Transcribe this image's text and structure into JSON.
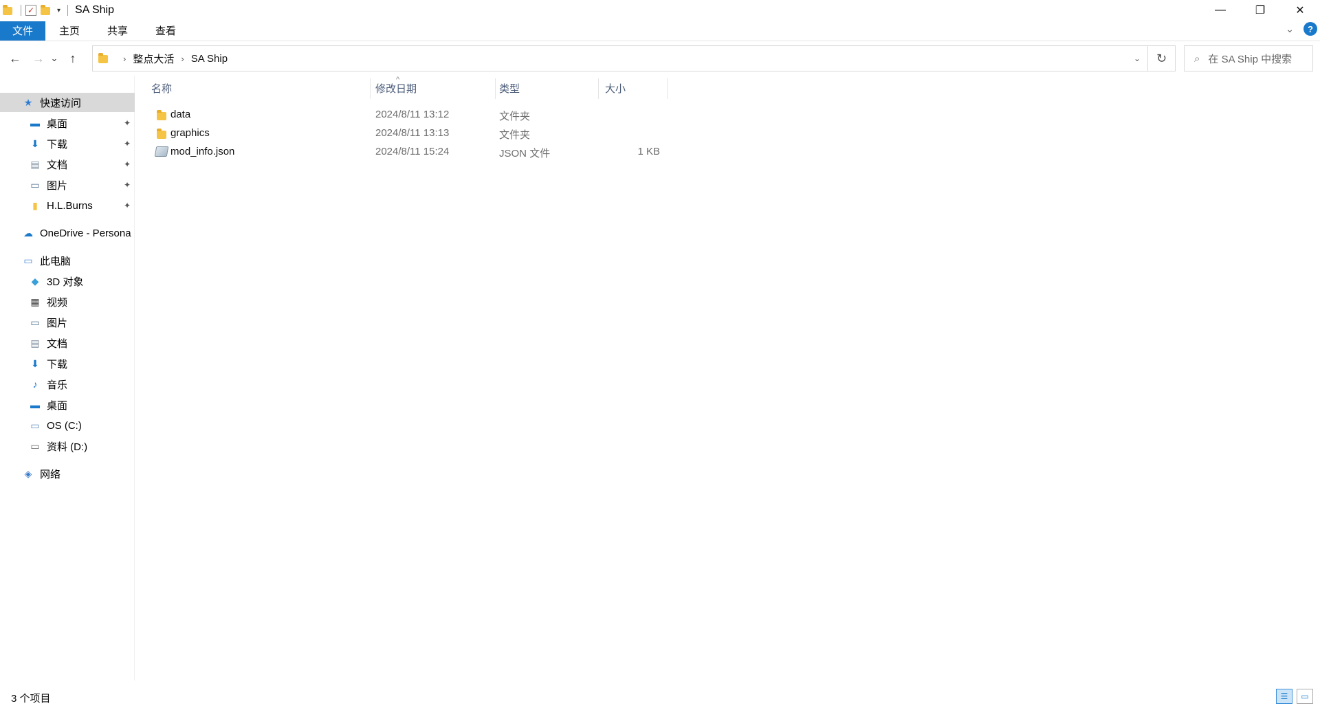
{
  "titlebar": {
    "title": "SA Ship",
    "qat_icons": [
      "folder-icon",
      "properties-icon",
      "new-folder-icon"
    ],
    "controls": {
      "minimize": "—",
      "restore": "❐",
      "close": "✕"
    }
  },
  "ribbon": {
    "tabs": [
      "文件",
      "主页",
      "共享",
      "查看"
    ],
    "expand_icon": "⌄",
    "help_icon": "?"
  },
  "navigation": {
    "back": "←",
    "forward": "→",
    "recent": "⌄",
    "up": "↑"
  },
  "address": {
    "crumbs": [
      "整点大活",
      "SA Ship"
    ],
    "separator": "›",
    "dropdown": "⌄",
    "refresh": "↻"
  },
  "search": {
    "placeholder": "在 SA Ship 中搜索",
    "icon": "⌕"
  },
  "sidebar": {
    "items": [
      {
        "label": "快速访问",
        "icon": "★",
        "pinned": false
      },
      {
        "label": "桌面",
        "icon": "▬",
        "pinned": true
      },
      {
        "label": "下载",
        "icon": "⬇",
        "pinned": true
      },
      {
        "label": "文档",
        "icon": "▤",
        "pinned": true
      },
      {
        "label": "图片",
        "icon": "▭",
        "pinned": true
      },
      {
        "label": "H.L.Burns",
        "icon": "▮",
        "pinned": true
      },
      {
        "label": "OneDrive - Persona",
        "icon": "☁",
        "pinned": false
      },
      {
        "label": "此电脑",
        "icon": "▭",
        "pinned": false
      },
      {
        "label": "3D 对象",
        "icon": "◆",
        "pinned": false
      },
      {
        "label": "视频",
        "icon": "▦",
        "pinned": false
      },
      {
        "label": "图片",
        "icon": "▭",
        "pinned": false
      },
      {
        "label": "文档",
        "icon": "▤",
        "pinned": false
      },
      {
        "label": "下载",
        "icon": "⬇",
        "pinned": false
      },
      {
        "label": "音乐",
        "icon": "♪",
        "pinned": false
      },
      {
        "label": "桌面",
        "icon": "▬",
        "pinned": false
      },
      {
        "label": "OS (C:)",
        "icon": "▭",
        "pinned": false
      },
      {
        "label": "资料 (D:)",
        "icon": "▭",
        "pinned": false
      },
      {
        "label": "网络",
        "icon": "◈",
        "pinned": false
      }
    ],
    "pin_icon": "📌"
  },
  "filelist": {
    "columns": [
      "名称",
      "修改日期",
      "类型",
      "大小"
    ],
    "sort_arrow": "^",
    "rows": [
      {
        "name": "data",
        "date": "2024/8/11 13:12",
        "type": "文件夹",
        "size": ""
      },
      {
        "name": "graphics",
        "date": "2024/8/11 13:13",
        "type": "文件夹",
        "size": ""
      },
      {
        "name": "mod_info.json",
        "date": "2024/8/11 15:24",
        "type": "JSON 文件",
        "size": "1 KB"
      }
    ]
  },
  "statusbar": {
    "item_count": "3 个项目"
  },
  "colors": {
    "accent": "#1979ca",
    "selected_nav": "#d9d9d9",
    "folder": "#f6c444",
    "header_text": "#4b5c79",
    "meta_text": "#6d6d6d"
  }
}
